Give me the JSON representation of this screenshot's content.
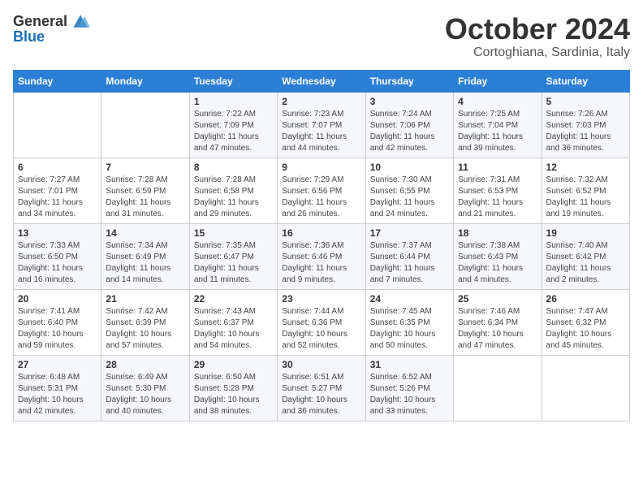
{
  "logo": {
    "general": "General",
    "blue": "Blue"
  },
  "header": {
    "month": "October 2024",
    "location": "Cortoghiana, Sardinia, Italy"
  },
  "days_of_week": [
    "Sunday",
    "Monday",
    "Tuesday",
    "Wednesday",
    "Thursday",
    "Friday",
    "Saturday"
  ],
  "weeks": [
    [
      {
        "day": null
      },
      {
        "day": null
      },
      {
        "day": 1,
        "sunrise": "7:22 AM",
        "sunset": "7:09 PM",
        "daylight": "11 hours and 47 minutes."
      },
      {
        "day": 2,
        "sunrise": "7:23 AM",
        "sunset": "7:07 PM",
        "daylight": "11 hours and 44 minutes."
      },
      {
        "day": 3,
        "sunrise": "7:24 AM",
        "sunset": "7:06 PM",
        "daylight": "11 hours and 42 minutes."
      },
      {
        "day": 4,
        "sunrise": "7:25 AM",
        "sunset": "7:04 PM",
        "daylight": "11 hours and 39 minutes."
      },
      {
        "day": 5,
        "sunrise": "7:26 AM",
        "sunset": "7:03 PM",
        "daylight": "11 hours and 36 minutes."
      }
    ],
    [
      {
        "day": 6,
        "sunrise": "7:27 AM",
        "sunset": "7:01 PM",
        "daylight": "11 hours and 34 minutes."
      },
      {
        "day": 7,
        "sunrise": "7:28 AM",
        "sunset": "6:59 PM",
        "daylight": "11 hours and 31 minutes."
      },
      {
        "day": 8,
        "sunrise": "7:28 AM",
        "sunset": "6:58 PM",
        "daylight": "11 hours and 29 minutes."
      },
      {
        "day": 9,
        "sunrise": "7:29 AM",
        "sunset": "6:56 PM",
        "daylight": "11 hours and 26 minutes."
      },
      {
        "day": 10,
        "sunrise": "7:30 AM",
        "sunset": "6:55 PM",
        "daylight": "11 hours and 24 minutes."
      },
      {
        "day": 11,
        "sunrise": "7:31 AM",
        "sunset": "6:53 PM",
        "daylight": "11 hours and 21 minutes."
      },
      {
        "day": 12,
        "sunrise": "7:32 AM",
        "sunset": "6:52 PM",
        "daylight": "11 hours and 19 minutes."
      }
    ],
    [
      {
        "day": 13,
        "sunrise": "7:33 AM",
        "sunset": "6:50 PM",
        "daylight": "11 hours and 16 minutes."
      },
      {
        "day": 14,
        "sunrise": "7:34 AM",
        "sunset": "6:49 PM",
        "daylight": "11 hours and 14 minutes."
      },
      {
        "day": 15,
        "sunrise": "7:35 AM",
        "sunset": "6:47 PM",
        "daylight": "11 hours and 11 minutes."
      },
      {
        "day": 16,
        "sunrise": "7:36 AM",
        "sunset": "6:46 PM",
        "daylight": "11 hours and 9 minutes."
      },
      {
        "day": 17,
        "sunrise": "7:37 AM",
        "sunset": "6:44 PM",
        "daylight": "11 hours and 7 minutes."
      },
      {
        "day": 18,
        "sunrise": "7:38 AM",
        "sunset": "6:43 PM",
        "daylight": "11 hours and 4 minutes."
      },
      {
        "day": 19,
        "sunrise": "7:40 AM",
        "sunset": "6:42 PM",
        "daylight": "11 hours and 2 minutes."
      }
    ],
    [
      {
        "day": 20,
        "sunrise": "7:41 AM",
        "sunset": "6:40 PM",
        "daylight": "10 hours and 59 minutes."
      },
      {
        "day": 21,
        "sunrise": "7:42 AM",
        "sunset": "6:39 PM",
        "daylight": "10 hours and 57 minutes."
      },
      {
        "day": 22,
        "sunrise": "7:43 AM",
        "sunset": "6:37 PM",
        "daylight": "10 hours and 54 minutes."
      },
      {
        "day": 23,
        "sunrise": "7:44 AM",
        "sunset": "6:36 PM",
        "daylight": "10 hours and 52 minutes."
      },
      {
        "day": 24,
        "sunrise": "7:45 AM",
        "sunset": "6:35 PM",
        "daylight": "10 hours and 50 minutes."
      },
      {
        "day": 25,
        "sunrise": "7:46 AM",
        "sunset": "6:34 PM",
        "daylight": "10 hours and 47 minutes."
      },
      {
        "day": 26,
        "sunrise": "7:47 AM",
        "sunset": "6:32 PM",
        "daylight": "10 hours and 45 minutes."
      }
    ],
    [
      {
        "day": 27,
        "sunrise": "6:48 AM",
        "sunset": "5:31 PM",
        "daylight": "10 hours and 42 minutes."
      },
      {
        "day": 28,
        "sunrise": "6:49 AM",
        "sunset": "5:30 PM",
        "daylight": "10 hours and 40 minutes."
      },
      {
        "day": 29,
        "sunrise": "6:50 AM",
        "sunset": "5:28 PM",
        "daylight": "10 hours and 38 minutes."
      },
      {
        "day": 30,
        "sunrise": "6:51 AM",
        "sunset": "5:27 PM",
        "daylight": "10 hours and 36 minutes."
      },
      {
        "day": 31,
        "sunrise": "6:52 AM",
        "sunset": "5:26 PM",
        "daylight": "10 hours and 33 minutes."
      },
      {
        "day": null
      },
      {
        "day": null
      }
    ]
  ]
}
